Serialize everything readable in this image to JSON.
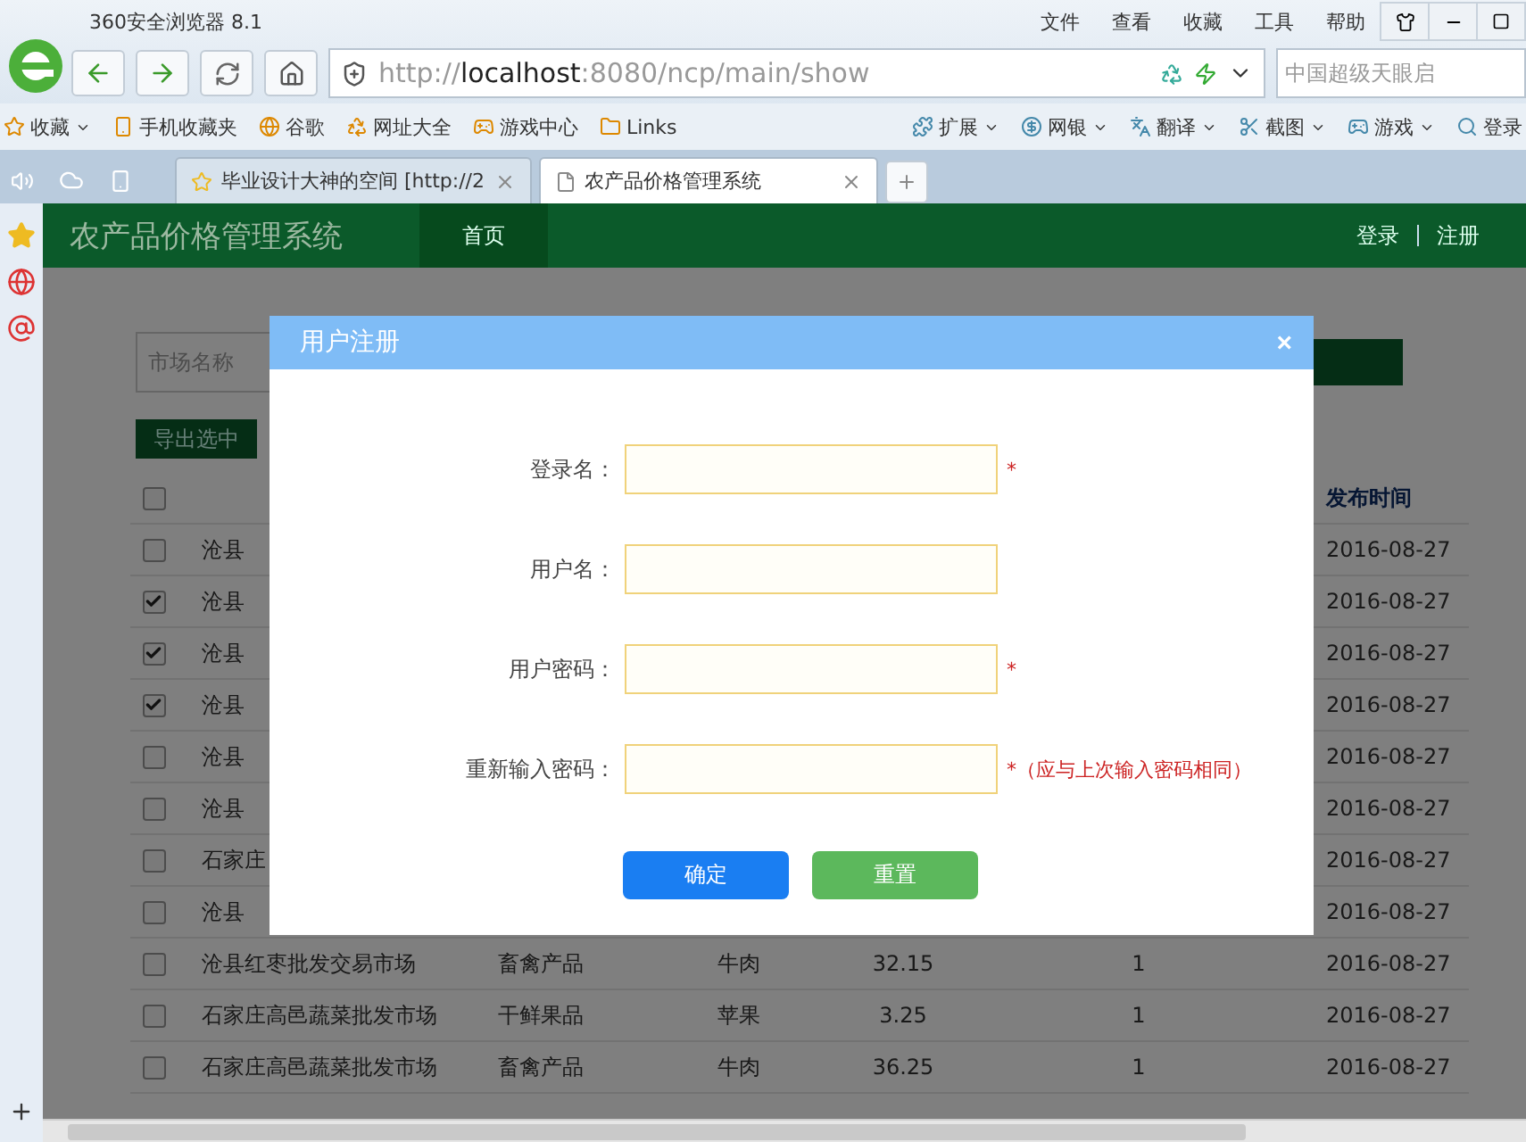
{
  "browser": {
    "title": "360安全浏览器 8.1",
    "menu": [
      "文件",
      "查看",
      "收藏",
      "工具",
      "帮助"
    ],
    "url": "http://**localhost**:8080/ncp/main/show",
    "search_placeholder": "中国超级天眼启",
    "bookmarks": [
      {
        "label": "收藏",
        "dropdown": true
      },
      {
        "label": "手机收藏夹",
        "dropdown": false
      },
      {
        "label": "谷歌",
        "dropdown": false
      },
      {
        "label": "网址大全",
        "dropdown": false
      },
      {
        "label": "游戏中心",
        "dropdown": false
      },
      {
        "label": "Links",
        "dropdown": false
      }
    ],
    "tools": [
      {
        "label": "扩展",
        "dropdown": true
      },
      {
        "label": "网银",
        "dropdown": true
      },
      {
        "label": "翻译",
        "dropdown": true
      },
      {
        "label": "截图",
        "dropdown": true
      },
      {
        "label": "游戏",
        "dropdown": true
      },
      {
        "label": "登录",
        "dropdown": false
      }
    ],
    "tabs": [
      {
        "label": "毕业设计大神的空间 [http://2",
        "selected": false
      },
      {
        "label": "农产品价格管理系统",
        "selected": true
      }
    ]
  },
  "site": {
    "title": "农产品价格管理系统",
    "nav": [
      {
        "label": "首页",
        "selected": true
      }
    ],
    "auth_links": [
      "登录",
      "注册"
    ],
    "search_placeholder": "市场名称",
    "export_button": "导出选中"
  },
  "table": {
    "select_all_checked": false,
    "date_column": "发布时间",
    "rows": [
      {
        "checked": false,
        "market": "沧县",
        "date": "2016-08-27"
      },
      {
        "checked": true,
        "market": "沧县",
        "date": "2016-08-27"
      },
      {
        "checked": true,
        "market": "沧县",
        "date": "2016-08-27"
      },
      {
        "checked": true,
        "market": "沧县",
        "date": "2016-08-27"
      },
      {
        "checked": false,
        "market": "沧县",
        "date": "2016-08-27"
      },
      {
        "checked": false,
        "market": "沧县",
        "date": "2016-08-27"
      },
      {
        "checked": false,
        "market": "石家庄",
        "date": "2016-08-27"
      },
      {
        "checked": false,
        "market": "沧县",
        "date": "2016-08-27"
      },
      {
        "checked": false,
        "market": "沧县红枣批发交易市场",
        "category": "畜禽产品",
        "product": "牛肉",
        "price": "32.15",
        "unit": "1",
        "date": "2016-08-27"
      },
      {
        "checked": false,
        "market": "石家庄高邑蔬菜批发市场",
        "category": "干鲜果品",
        "product": "苹果",
        "price": "3.25",
        "unit": "1",
        "date": "2016-08-27"
      },
      {
        "checked": false,
        "market": "石家庄高邑蔬菜批发市场",
        "category": "畜禽产品",
        "product": "牛肉",
        "price": "36.25",
        "unit": "1",
        "date": "2016-08-27"
      }
    ]
  },
  "modal": {
    "title": "用户注册",
    "close": "×",
    "fields": [
      {
        "label": "登录名：",
        "mark": "*"
      },
      {
        "label": "用户名："
      },
      {
        "label": "用户密码：",
        "mark": "*"
      },
      {
        "label": "重新输入密码：",
        "mark": "*",
        "hint": "（应与上次输入密码相同）"
      }
    ],
    "buttons": [
      {
        "label": "确定",
        "kind": "primary"
      },
      {
        "label": "重置",
        "kind": "reset"
      }
    ]
  }
}
